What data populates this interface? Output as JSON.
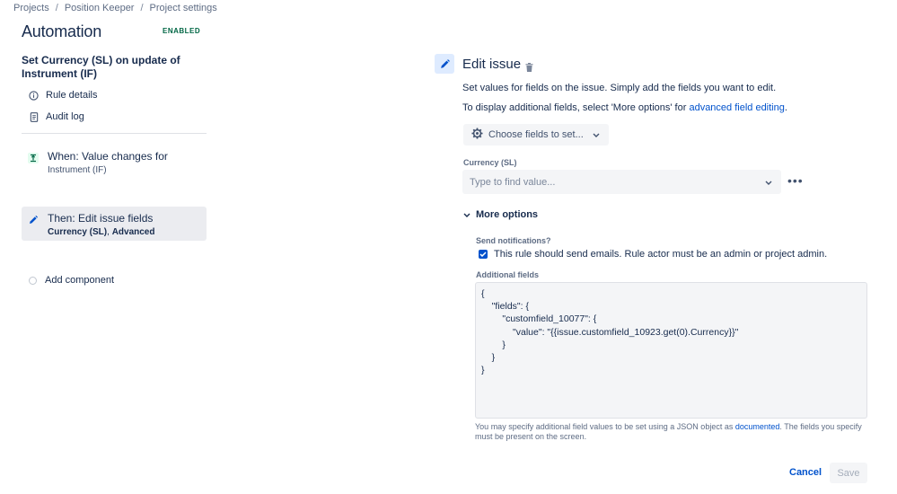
{
  "breadcrumb": {
    "items": [
      "Projects",
      "Position Keeper",
      "Project settings"
    ],
    "separator": "/"
  },
  "header": {
    "title": "Automation",
    "status_badge": "ENABLED"
  },
  "rule": {
    "name": "Set Currency (SL) on update of Instrument (IF)"
  },
  "nav": {
    "rule_details": "Rule details",
    "audit_log": "Audit log"
  },
  "components": {
    "trigger": {
      "title": "When: Value changes for",
      "subtitle": "Instrument (IF)"
    },
    "action": {
      "title": "Then: Edit issue fields",
      "subtitle_bold1": "Currency (SL)",
      "subtitle_sep": ", ",
      "subtitle_bold2": "Advanced"
    },
    "add_label": "Add component"
  },
  "panel": {
    "title": "Edit issue",
    "desc1": "Set values for fields on the issue. Simply add the fields you want to edit.",
    "desc2_prefix": "To display additional fields, select 'More options' for ",
    "desc2_link": "advanced field editing",
    "desc2_suffix": ".",
    "choose_fields_label": "Choose fields to set...",
    "currency_label": "Currency (SL)",
    "currency_placeholder": "Type to find value...",
    "more_dots": "•••",
    "more_options_label": "More options",
    "send_notifications_label": "Send notifications?",
    "send_notifications_checked": true,
    "send_notifications_text": "This rule should send emails. Rule actor must be an admin or project admin.",
    "additional_fields_label": "Additional fields",
    "additional_fields_value": "{\n    \"fields\": {\n        \"customfield_10077\": {\n            \"value\": \"{{issue.customfield_10923.get(0).Currency}}\"\n        }\n    }\n}",
    "help_prefix": "You may specify additional field values to be set using a JSON object as ",
    "help_link": "documented",
    "help_suffix": ". The fields you specify must be present on the screen.",
    "cancel_label": "Cancel",
    "save_label": "Save"
  },
  "colors": {
    "accent": "#0052cc",
    "success": "#006644",
    "text": "#172b4d",
    "subtle_bg": "#f4f5f7"
  },
  "icons": {
    "rule_details": "info-icon",
    "audit_log": "document-icon",
    "trigger": "value-change-icon",
    "action": "pencil-icon",
    "trash": "trash-icon",
    "gear": "gear-icon",
    "chevron": "chevron-down-icon"
  }
}
